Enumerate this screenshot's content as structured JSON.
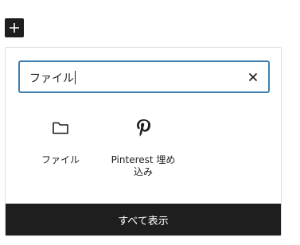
{
  "toolbar": {
    "add_icon": "plus-icon"
  },
  "inserter": {
    "search": {
      "value": "ファイル",
      "clear_icon": "close-icon"
    },
    "blocks": [
      {
        "label": "ファイル",
        "icon": "folder-icon"
      },
      {
        "label": "Pinterest 埋め込み",
        "icon": "pinterest-icon"
      }
    ],
    "footer_label": "すべて表示"
  },
  "colors": {
    "focus_border": "#3f7fb0",
    "dark": "#1e1e1e",
    "panel_border": "#dddddd"
  }
}
